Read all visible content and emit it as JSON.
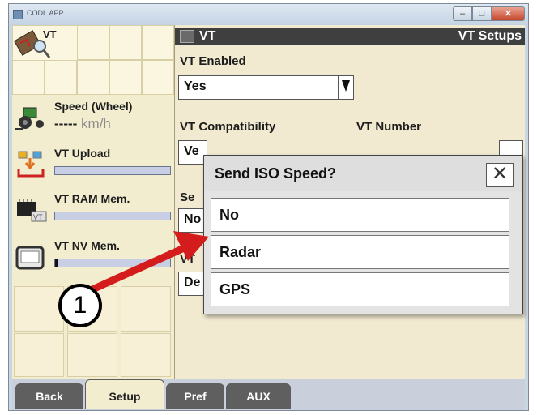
{
  "window": {
    "title": "CODL.APP",
    "min_icon": "minimize-icon",
    "max_icon": "maximize-icon",
    "close_icon": "close-icon"
  },
  "sidebar": {
    "vt_label": "VT",
    "statuses": [
      {
        "label": "Speed (Wheel)",
        "value_dashes": "-----",
        "unit": "km/h",
        "icon": "tractor-icon"
      },
      {
        "label": "VT Upload",
        "progress": 0.0,
        "icon": "upload-icon"
      },
      {
        "label": "VT RAM Mem.",
        "progress": 0.0,
        "icon": "ram-chip-icon"
      },
      {
        "label": "VT NV Mem.",
        "progress": 0.03,
        "icon": "monitor-icon"
      }
    ]
  },
  "header": {
    "left": "VT",
    "right": "VT Setups"
  },
  "fields": {
    "vt_enabled_label": "VT Enabled",
    "vt_enabled_value": "Yes",
    "vt_compat_label": "VT Compatibility",
    "vt_compat_value": "Ve",
    "vt_number_label": "VT Number",
    "third_label_partial": "Se",
    "third_value_partial": "No",
    "fourth_label_partial": "VT",
    "fourth_value_partial": "De"
  },
  "dialog": {
    "title": "Send ISO Speed?",
    "close_symbol": "✕",
    "options": [
      "No",
      "Radar",
      "GPS"
    ]
  },
  "callout": {
    "number": "1"
  },
  "tabs": [
    "Back",
    "Setup",
    "Pref",
    "AUX"
  ],
  "colors": {
    "arrow": "#d41c1c",
    "background": "#ece0ad"
  }
}
